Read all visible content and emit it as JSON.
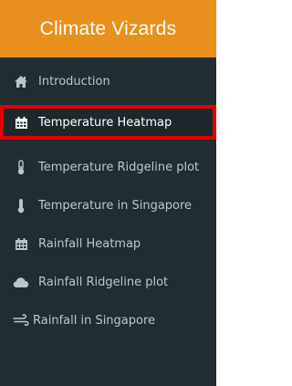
{
  "header": {
    "title": "Climate Vizards"
  },
  "sidebar": {
    "items": [
      {
        "label": "Introduction",
        "icon": "home-icon",
        "active": false
      },
      {
        "label": "Temperature Heatmap",
        "icon": "calendar-icon",
        "active": true
      },
      {
        "label": "Temperature Ridgeline plot",
        "icon": "thermometer-half-icon",
        "active": false
      },
      {
        "label": "Temperature in Singapore",
        "icon": "thermometer-full-icon",
        "active": false
      },
      {
        "label": "Rainfall Heatmap",
        "icon": "calendar-icon",
        "active": false
      },
      {
        "label": "Rainfall Ridgeline plot",
        "icon": "cloud-icon",
        "active": false
      },
      {
        "label": "Rainfall in Singapore",
        "icon": "wind-icon",
        "active": false
      }
    ]
  },
  "colors": {
    "header_bg": "#e8911e",
    "sidebar_bg": "#222d32",
    "active_outline": "#e00000",
    "label_color": "#b8c7ce",
    "active_label_color": "#ffffff"
  }
}
